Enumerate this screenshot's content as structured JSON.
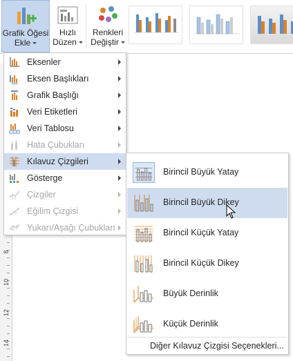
{
  "ribbon": {
    "add_element": {
      "label1": "Grafik Öğesi",
      "label2": "Ekle"
    },
    "quick_layout": {
      "label1": "Hızlı",
      "label2": "Düzen"
    },
    "colors": {
      "label1": "Renkleri",
      "label2": "Değiştir"
    }
  },
  "menu": {
    "items": [
      {
        "label": "Eksenler",
        "enabled": true,
        "icon": "axes-icon"
      },
      {
        "label": "Eksen Başlıkları",
        "enabled": true,
        "icon": "axis-titles-icon"
      },
      {
        "label": "Grafik Başlığı",
        "enabled": true,
        "icon": "chart-title-icon"
      },
      {
        "label": "Veri Etiketleri",
        "enabled": true,
        "icon": "data-labels-icon"
      },
      {
        "label": "Veri Tablosu",
        "enabled": true,
        "icon": "data-table-icon"
      },
      {
        "label": "Hata Çubukları",
        "enabled": false,
        "icon": "error-bars-icon"
      },
      {
        "label": "Kılavuz Çizgileri",
        "enabled": true,
        "icon": "gridlines-icon",
        "active": true
      },
      {
        "label": "Gösterge",
        "enabled": true,
        "icon": "legend-icon"
      },
      {
        "label": "Çizgiler",
        "enabled": false,
        "icon": "lines-icon"
      },
      {
        "label": "Eğilim Çizgisi",
        "enabled": false,
        "icon": "trendline-icon"
      },
      {
        "label": "Yukarı/Aşağı Çubukları",
        "enabled": false,
        "icon": "up-down-bars-icon"
      }
    ]
  },
  "submenu": {
    "items": [
      {
        "label": "Birincil Büyük Yatay",
        "icon": "primary-major-horizontal-icon",
        "selected": true
      },
      {
        "label": "Birincil Büyük Dikey",
        "icon": "primary-major-vertical-icon",
        "hovered": true
      },
      {
        "label": "Birincil Küçük Yatay",
        "icon": "primary-minor-horizontal-icon"
      },
      {
        "label": "Birincil Küçük Dikey",
        "icon": "primary-minor-vertical-icon"
      },
      {
        "label": "Büyük Derinlik",
        "icon": "major-depth-icon"
      },
      {
        "label": "Küçük Derinlik",
        "icon": "minor-depth-icon"
      }
    ],
    "more_options": "Diğer Kılavuz Çizgisi Seçenekleri..."
  },
  "ruler": {
    "numbers": [
      "8",
      "10",
      "12",
      "14"
    ]
  },
  "colors": {
    "menu_highlight": "#cfdcf0",
    "ribbon_selected": "#c5d7ee",
    "icon_orange": "#d9822b",
    "icon_blue": "#5b8fc7"
  }
}
